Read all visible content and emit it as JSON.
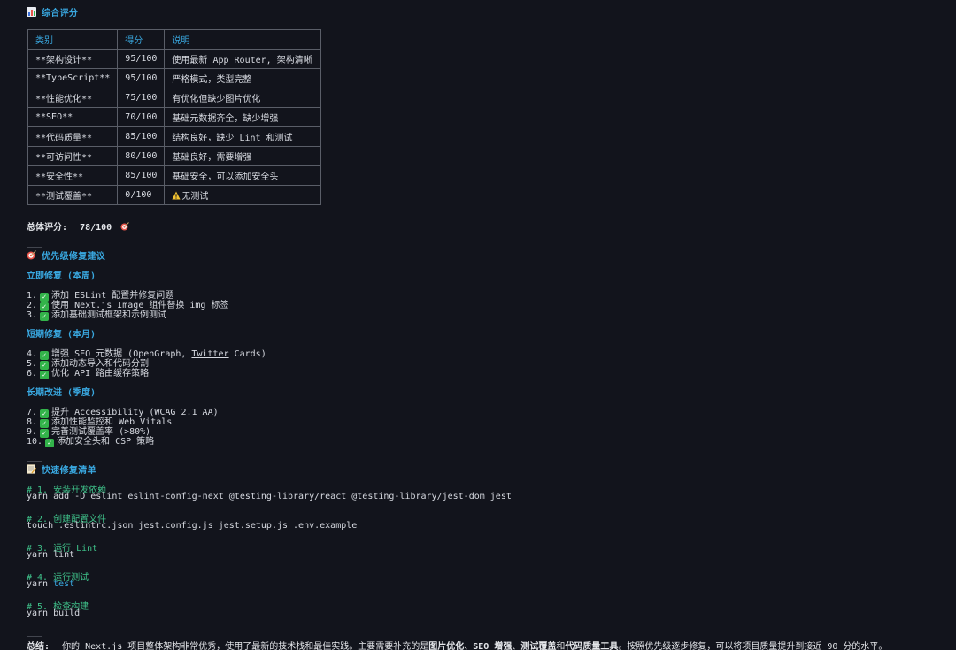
{
  "section_score": {
    "title": "综合评分",
    "table": {
      "headers": [
        "类别",
        "得分",
        "说明"
      ],
      "rows": [
        [
          "**架构设计**",
          "95/100",
          "使用最新 App Router, 架构清晰"
        ],
        [
          "**TypeScript**",
          "95/100",
          "严格模式，类型完整"
        ],
        [
          "**性能优化**",
          "75/100",
          "有优化但缺少图片优化"
        ],
        [
          "**SEO**",
          "70/100",
          "基础元数据齐全，缺少增强"
        ],
        [
          "**代码质量**",
          "85/100",
          "结构良好，缺少 Lint 和测试"
        ],
        [
          "**可访问性**",
          "80/100",
          "基础良好，需要增强"
        ],
        [
          "**安全性**",
          "85/100",
          "基础安全，可以添加安全头"
        ],
        [
          "**测试覆盖**",
          "0/100",
          "无测试"
        ]
      ]
    },
    "total_label": "总体评分:",
    "total_value": "78/100"
  },
  "rule": "___",
  "section_priority": {
    "title": "优先级修复建议",
    "groups": [
      {
        "title": "立即修复 (本周)",
        "items": [
          {
            "num": "1.",
            "text": "添加 ESLint 配置并修复问题"
          },
          {
            "num": "2.",
            "text": "使用 Next.js Image 组件替换 img 标签"
          },
          {
            "num": "3.",
            "text": "添加基础测试框架和示例测试"
          }
        ]
      },
      {
        "title": "短期修复 (本月)",
        "items": [
          {
            "num": "4.",
            "text_a": "增强 SEO 元数据 (OpenGraph, ",
            "text_link": "Twitter",
            "text_b": " Cards)"
          },
          {
            "num": "5.",
            "text": "添加动态导入和代码分割"
          },
          {
            "num": "6.",
            "text": "优化 API 路由缓存策略"
          }
        ]
      },
      {
        "title": "长期改进 (季度)",
        "items": [
          {
            "num": "7.",
            "text": "提升 Accessibility (WCAG 2.1 AA)"
          },
          {
            "num": "8.",
            "text": "添加性能监控和 Web Vitals"
          },
          {
            "num": "9.",
            "text": "完善测试覆盖率 (>80%)"
          },
          {
            "num": "10.",
            "text": "添加安全头和 CSP 策略"
          }
        ]
      }
    ]
  },
  "section_quickfix": {
    "title": "快速修复清单",
    "steps": [
      {
        "comment": "# 1. 安装开发依赖",
        "command": "yarn add -D eslint eslint-config-next @testing-library/react @testing-library/jest-dom jest"
      },
      {
        "comment": "# 2. 创建配置文件",
        "command": "touch .eslintrc.json jest.config.js jest.setup.js .env.example"
      },
      {
        "comment": "# 3. 运行 Lint",
        "command": "yarn lint"
      },
      {
        "comment": "# 4. 运行测试",
        "command_a": "yarn ",
        "command_kw": "test"
      },
      {
        "comment": "# 5. 检查构建",
        "command": "yarn build"
      }
    ]
  },
  "summary": {
    "label": "总结:",
    "text_a": "你的 Next.js 项目整体架构非常优秀，使用了最新的技术栈和最佳实践。主要需要补充的是",
    "bold_1": "图片优化",
    "sep_1": "、",
    "bold_2": "SEO 增强",
    "sep_2": "、",
    "bold_3": "测试覆盖",
    "sep_3": "和",
    "bold_4": "代码质量工具",
    "text_b": "。按照优先级逐步修复，可以将项目质量提升到接近 90 分的水平。"
  },
  "colors": {
    "background": "#12141c",
    "heading": "#39a8e0",
    "comment": "#3fc28a",
    "check": "#33b34a",
    "warning": "#f2c230",
    "target_icon": "#e8554a"
  },
  "icons": [
    "bar-chart-icon",
    "target-icon",
    "check-mark-icon",
    "warning-icon",
    "memo-icon"
  ]
}
